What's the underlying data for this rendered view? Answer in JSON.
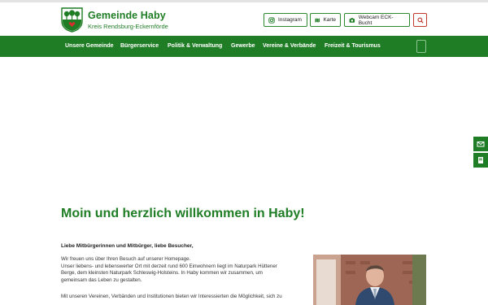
{
  "header": {
    "title": "Gemeinde Haby",
    "subtitle": "Kreis Rendsburg-Eckernförde",
    "buttons": {
      "instagram": "Instagram",
      "karte": "Karte",
      "webcam": "Webcam ECK-Bucht"
    }
  },
  "nav": {
    "items": [
      "Unsere Gemeinde",
      "Bürgerservice",
      "Politik & Verwaltung",
      "Gewerbe",
      "Vereine & Verbände",
      "Freizeit & Tourismus"
    ]
  },
  "content": {
    "headline": "Moin und herzlich willkommen in Haby!",
    "greeting": "Liebe Mitbürgerinnen und Mitbürger, liebe Besucher,",
    "paragraph1": [
      "Wir freuen uns über Ihren Besuch auf unserer Homepage.",
      "Unser liebens- und lebenswerter Ort mit derzeit rund 600 Einwohnern liegt im Naturpark Hüttener",
      "Berge, dem kleinsten Naturpark Schleswig-Holsteins. In Haby kommen wir zusammen, um",
      "gemeinsam das Leben zu gestalten."
    ],
    "paragraph2": [
      "Mit unseren Vereinen, Verbänden und Institutionen bieten wir Interessierten die Möglichkeit, sich zu"
    ]
  },
  "colors": {
    "brand_green": "#1f7d25",
    "search_red": "#c0392b"
  },
  "icons": {
    "logo": "municipal-coat-of-arms",
    "instagram": "instagram-icon",
    "karte": "map-icon",
    "webcam": "camera-icon",
    "search": "search-icon",
    "side1": "mail-icon",
    "side2": "book-icon"
  }
}
